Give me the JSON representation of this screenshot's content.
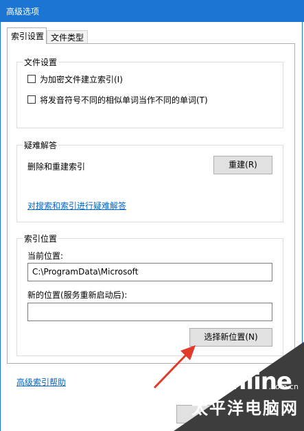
{
  "window": {
    "title": "高级选项"
  },
  "tabs": [
    {
      "label": "索引设置",
      "active": true
    },
    {
      "label": "文件类型",
      "active": false
    }
  ],
  "file_settings": {
    "title": "文件设置",
    "options": [
      {
        "label": "为加密文件建立索引(I)",
        "checked": false
      },
      {
        "label": "将发音符号不同的相似单词当作不同的单词(T)",
        "checked": false
      }
    ]
  },
  "troubleshoot": {
    "title": "疑难解答",
    "rebuild_text": "删除和重建索引",
    "rebuild_button": "重建(R)",
    "link": "对搜索和索引进行疑难解答"
  },
  "index_location": {
    "title": "索引位置",
    "current_label": "当前位置:",
    "current_value": "C:\\ProgramData\\Microsoft",
    "new_label": "新的位置(服务重新启动后):",
    "new_value": "",
    "select_button": "选择新位置(N)"
  },
  "footer": {
    "help_link": "高级索引帮助"
  },
  "watermark": {
    "brand": "PConline",
    "domain": ".com.cn",
    "chinese": "太平洋电脑网"
  },
  "colors": {
    "titlebar": "#1c74d3",
    "link": "#0066cc",
    "arrow": "#e23a2a"
  }
}
